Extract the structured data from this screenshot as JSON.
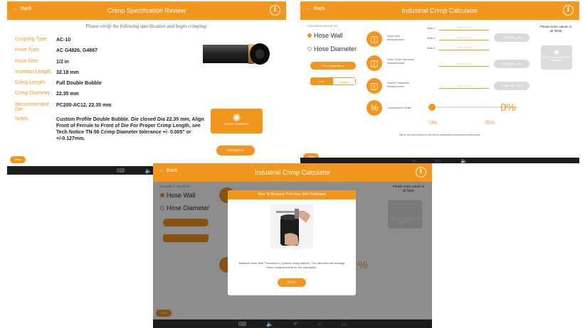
{
  "screen1": {
    "back_label": "Back",
    "title": "Crimp Specification Review",
    "instruction": "Please verify the following specification and begin crimping:",
    "specs": [
      {
        "key": "Coupling Type:",
        "value": "AC-10"
      },
      {
        "key": "Hose Type:",
        "value": "AC G4826, G4867"
      },
      {
        "key": "Hose Size:",
        "value": "1/2 in"
      },
      {
        "key": "Insertion Length:",
        "value": "32.18 mm"
      },
      {
        "key": "Crimp Length:",
        "value": "Full Double Bubble"
      },
      {
        "key": "Crimp Diameter:",
        "value": "22.35 mm"
      },
      {
        "key": "Recommended Die:",
        "value": "PC200-AC12, 22.35 mm"
      },
      {
        "key": "Notes:",
        "value": "Custom Profile Double Bubble.   Die closed Dia 22.35  mm, Align Front of Ferrule to Front of Die For Proper Crimp Length, see Tech Notice TN-56    Crimp Diameter tolerance +/- 0.005\" or +/-0.127mm."
      }
    ],
    "begin_label": "BEGIN CRIMPING",
    "options_label": "Set Options",
    "help_label": "Help",
    "accent_color": "#f3961e"
  },
  "screen2": {
    "back_label": "Back",
    "title": "Industrial Crimp Calculator",
    "calc_based_on": "Calculation Based On",
    "option_hose_wall": "Hose Wall",
    "option_hose_diameter": "Hose Diameter",
    "calc_button": "Crimp instructions",
    "unit_a": "mm",
    "unit_b": "inches",
    "measurements": [
      {
        "label": "Hose Wall Measurement",
        "icon": "hose-wall-icon"
      },
      {
        "label": "Stem Outer Diameter Measurement",
        "icon": "stem-diameter-icon"
      },
      {
        "label": "Sleeve Thickness Measurement",
        "icon": "sleeve-thickness-icon"
      }
    ],
    "side1": "Side 1",
    "side2": "Side 2",
    "side3": "Side 3",
    "field_placeholder": "enter decimal",
    "tap_label": "Enter/Tape - mm",
    "please_enter": "Please enter values in all fields",
    "select_die_label": "SELECT DIE AND BEGIN CRIMPING",
    "compression_label": "Compression Ratio",
    "compression_value": "0%",
    "slider_min": "0%",
    "slider_max": "35%",
    "hint": "Tap to and icon buttons to the left for additional measurement instructions.",
    "help_label": "Help"
  },
  "screen3": {
    "back_label": "Back",
    "title": "Industrial Crimp Calculator",
    "calc_based_on": "Calculation Based On",
    "option_hose_wall": "Hose Wall",
    "option_hose_diameter": "Hose Diameter",
    "please_enter": "Please enter values in all fields",
    "select_die_label": "SELECT DIE AND BEGIN CRIMPING",
    "pct_fragment": "%",
    "modal_title": "How To Measure The Hose Wall Thickness",
    "modal_text": "Measure Hose Wall Thickness in 3 places using calipers. The calculator will average these measurements for the calculation.",
    "close_label": "Close",
    "help_label": "Help"
  }
}
